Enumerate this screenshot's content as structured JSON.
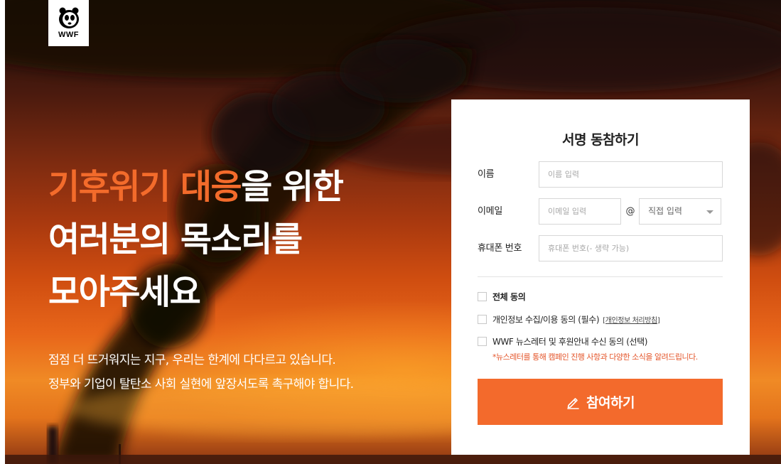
{
  "logo": {
    "text": "WWF"
  },
  "hero": {
    "headline": {
      "line1_accent": "기후위기 대응",
      "line1_rest": "을 위한",
      "line2": "여러분의 목소리를",
      "line3": "모아주세요"
    },
    "subcopy": {
      "line1": "점점 더 뜨거워지는 지구, 우리는 한계에 다다르고 있습니다.",
      "line2": "정부와 기업이 탈탄소 사회 실현에 앞장서도록 촉구해야 합니다."
    }
  },
  "form": {
    "title": "서명 동참하기",
    "name": {
      "label": "이름",
      "placeholder": "이름 입력",
      "value": ""
    },
    "email": {
      "label": "이메일",
      "placeholder": "이메일 입력",
      "value": "",
      "at": "@",
      "domain_selected": "직접 입력"
    },
    "phone": {
      "label": "휴대폰 번호",
      "placeholder": "휴대폰 번호(- 생략 가능)",
      "value": ""
    },
    "consents": {
      "all": "전체 동의",
      "privacy": "개인정보 수집/이용 동의 (필수)",
      "privacy_link": "[개인정보 처리방침]",
      "newsletter": "WWF 뉴스레터 및 후원안내 수신 동의 (선택)",
      "newsletter_note": "*뉴스레터를 통해 캠페인 진행 사항과 다양한 소식을 알려드립니다."
    },
    "submit_label": "참여하기"
  },
  "colors": {
    "accent": "#f36a2c",
    "note_red": "#e4552a",
    "panel_bg": "#ffffff"
  },
  "icons": {
    "logo": "panda-icon",
    "submit": "pencil-icon",
    "select": "chevron-down-icon"
  }
}
